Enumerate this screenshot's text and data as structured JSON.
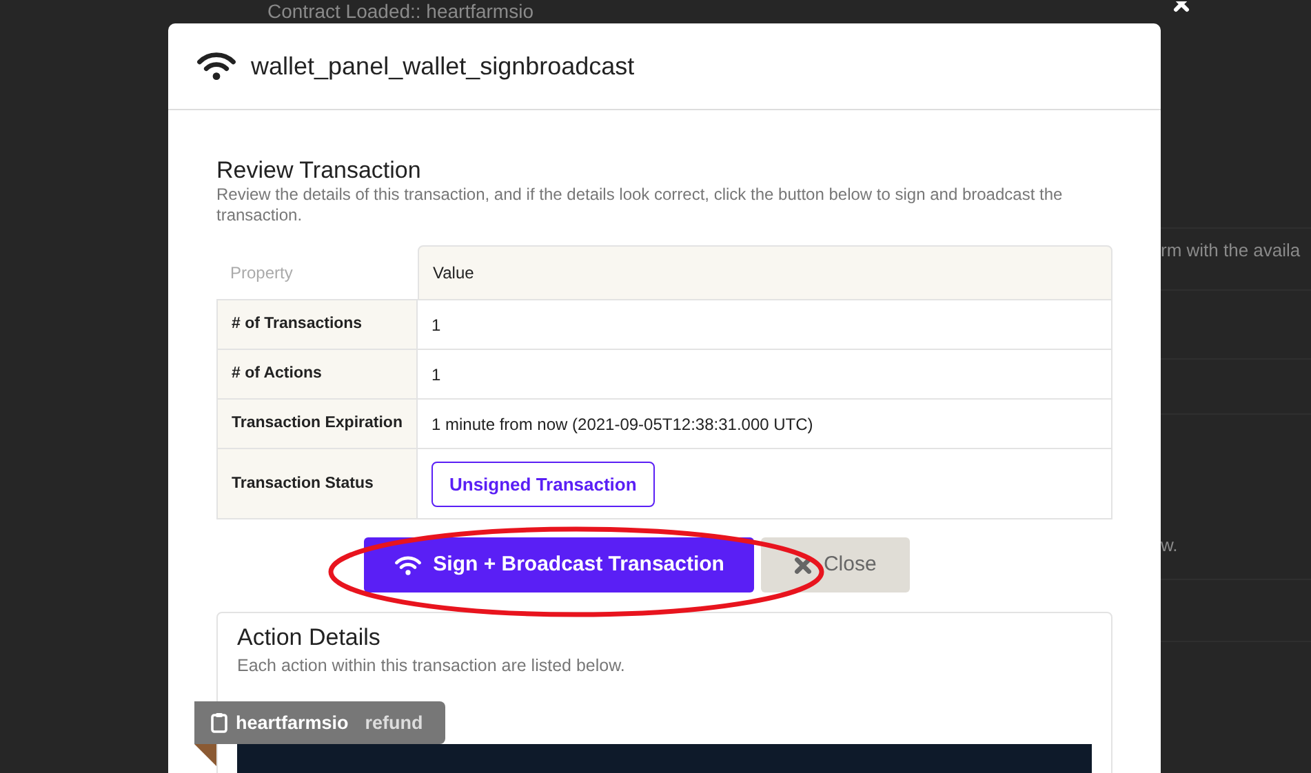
{
  "background": {
    "texts": [
      {
        "kind": "title",
        "text": "Contract Loaded:: heartfarmsio"
      },
      {
        "kind": "line",
        "text": "rm with the availa"
      },
      {
        "kind": "line",
        "text": "w."
      }
    ]
  },
  "modal": {
    "title": "wallet_panel_wallet_signbroadcast",
    "review": {
      "heading": "Review Transaction",
      "description": "Review the details of this transaction, and if the details look correct, click the button below to sign and broadcast the transaction.",
      "columns": [
        "Property",
        "Value"
      ],
      "rows": [
        {
          "property": "# of Transactions",
          "value": "1",
          "kind": "text"
        },
        {
          "property": "# of Actions",
          "value": "1",
          "kind": "text"
        },
        {
          "property": "Transaction Expiration",
          "value": "1 minute from now (2021-09-05T12:38:31.000 UTC)",
          "kind": "text"
        },
        {
          "property": "Transaction Status",
          "value": "Unsigned Transaction",
          "kind": "status"
        }
      ]
    },
    "buttons": [
      {
        "label": "Sign + Broadcast Transaction",
        "kind": "primary"
      },
      {
        "label": "Close",
        "kind": "close"
      }
    ],
    "action_details": {
      "heading": "Action Details",
      "description": "Each action within this transaction are listed below.",
      "actions": [
        {
          "contract": "heartfarmsio",
          "action": "refund"
        }
      ]
    }
  },
  "annotations": [
    {
      "kind": "ellipse",
      "color": "#e8141e"
    }
  ]
}
